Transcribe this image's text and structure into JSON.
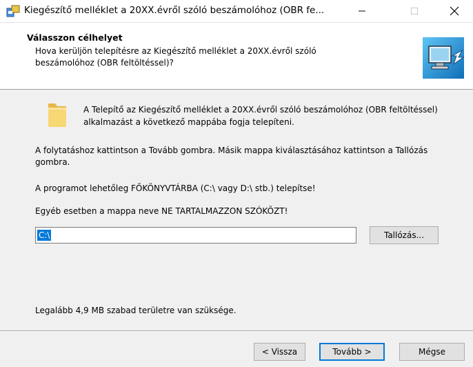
{
  "window": {
    "title": "Kiegészítő melléklet a 20XX.évről szóló beszámolóhoz (OBR fe...",
    "icons": {
      "app": "installer-icon",
      "minimize": "minimize-icon",
      "maximize": "maximize-icon",
      "close": "close-icon"
    }
  },
  "header": {
    "title": "Válasszon célhelyet",
    "subtitle": "Hova kerüljön telepítésre az Kiegészítő melléklet a 20XX.évről szóló beszámolóhoz (OBR feltöltéssel)?",
    "icon": "computer-install-icon"
  },
  "body": {
    "folder_icon": "folder-icon",
    "intro": "A Telepítő az Kiegészítő melléklet a 20XX.évről szóló beszámolóhoz (OBR feltöltéssel) alkalmazást a következő mappába fogja telepíteni.",
    "para1": "A folytatáshoz kattintson a Tovább gombra. Másik mappa kiválasztásához kattintson a Tallózás gombra.",
    "para2": "A programot lehetőleg FŐKÖNYVTÁRBA (C:\\ vagy D:\\ stb.) telepítse!",
    "para3": "Egyéb esetben a mappa neve NE TARTALMAZZON SZÓKÖZT!",
    "path_value": "C:\\",
    "browse_label": "Tallózás...",
    "space_required": "Legalább 4,9 MB szabad területre van szüksége."
  },
  "footer": {
    "back_label": "< Vissza",
    "next_label": "Tovább >",
    "cancel_label": "Mégse"
  },
  "colors": {
    "accent": "#0078d7",
    "header_bg": "#ffffff",
    "body_bg": "#f0f0f0"
  }
}
